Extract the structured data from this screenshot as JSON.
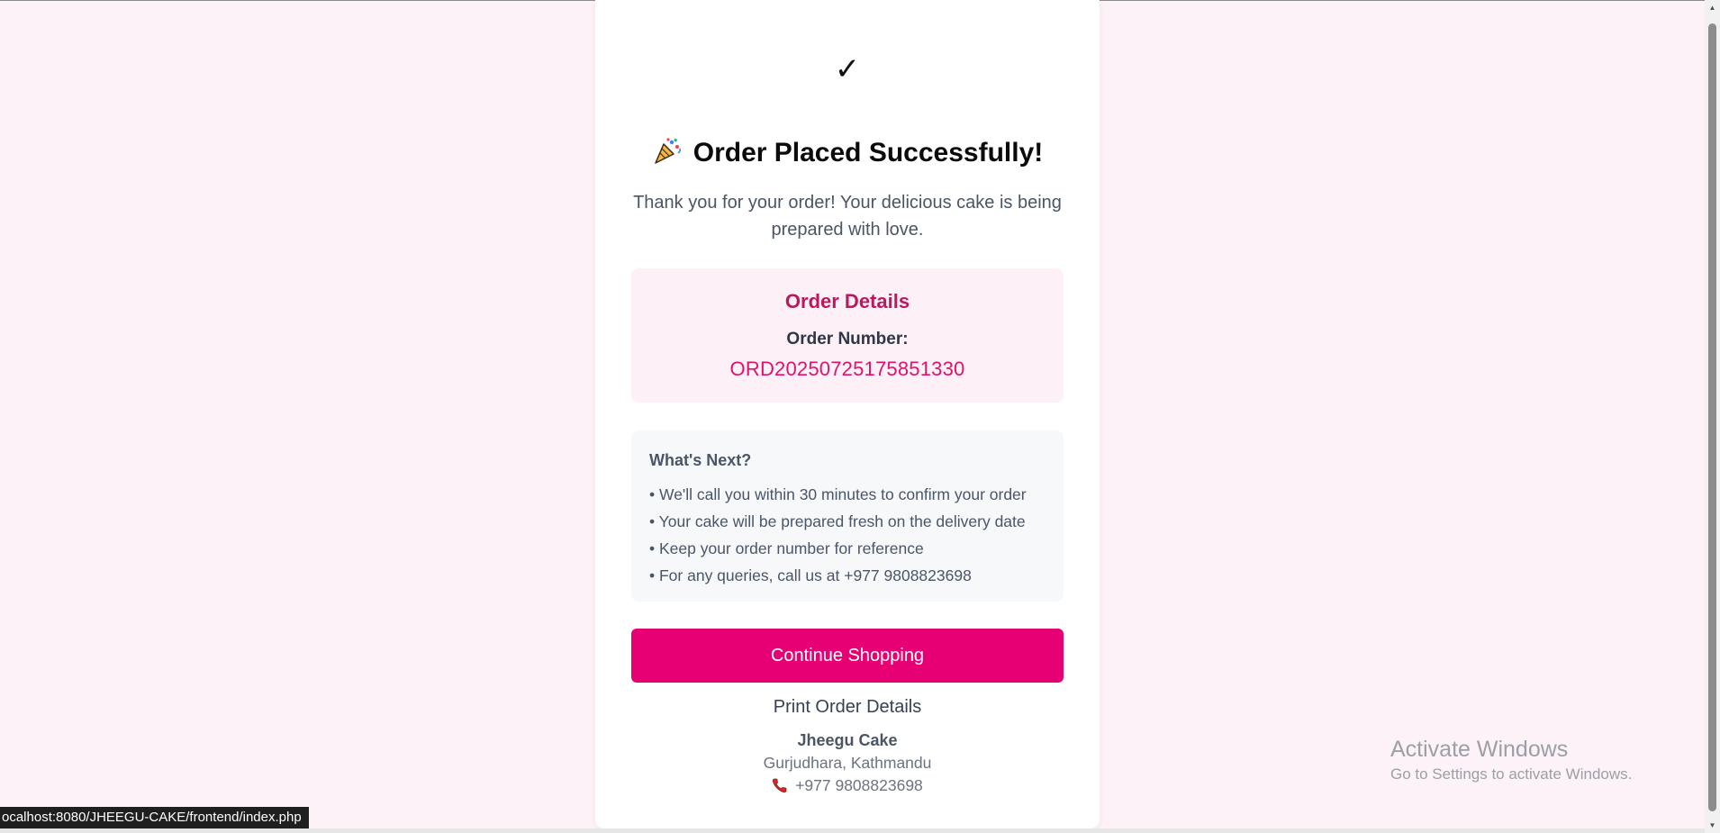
{
  "page": {
    "check_glyph": "✓",
    "title": "Order Placed Successfully!",
    "title_icon": "party-popper-icon",
    "subtitle": "Thank you for your order! Your delicious cake is being prepared with love."
  },
  "order_details": {
    "heading": "Order Details",
    "order_number_label": "Order Number:",
    "order_number": "ORD20250725175851330"
  },
  "whats_next": {
    "heading": "What's Next?",
    "items": [
      "• We'll call you within 30 minutes to confirm your order",
      "• Your cake will be prepared fresh on the delivery date",
      "• Keep your order number for reference",
      "• For any queries, call us at +977 9808823698"
    ]
  },
  "actions": {
    "continue_label": "Continue Shopping",
    "print_label": "Print Order Details"
  },
  "footer": {
    "shop_name": "Jheegu Cake",
    "address": "Gurjudhara, Kathmandu",
    "phone": "+977 9808823698",
    "phone_icon": "telephone-receiver-icon"
  },
  "windows_watermark": {
    "line1": "Activate Windows",
    "line2": "Go to Settings to activate Windows."
  },
  "status_bar": {
    "url": "ocalhost:8080/JHEEGU-CAKE/frontend/index.php"
  },
  "colors": {
    "page_bg": "#fdf2f8",
    "accent": "#e60073",
    "order_number": "#e3116c",
    "details_heading": "#be185d"
  }
}
